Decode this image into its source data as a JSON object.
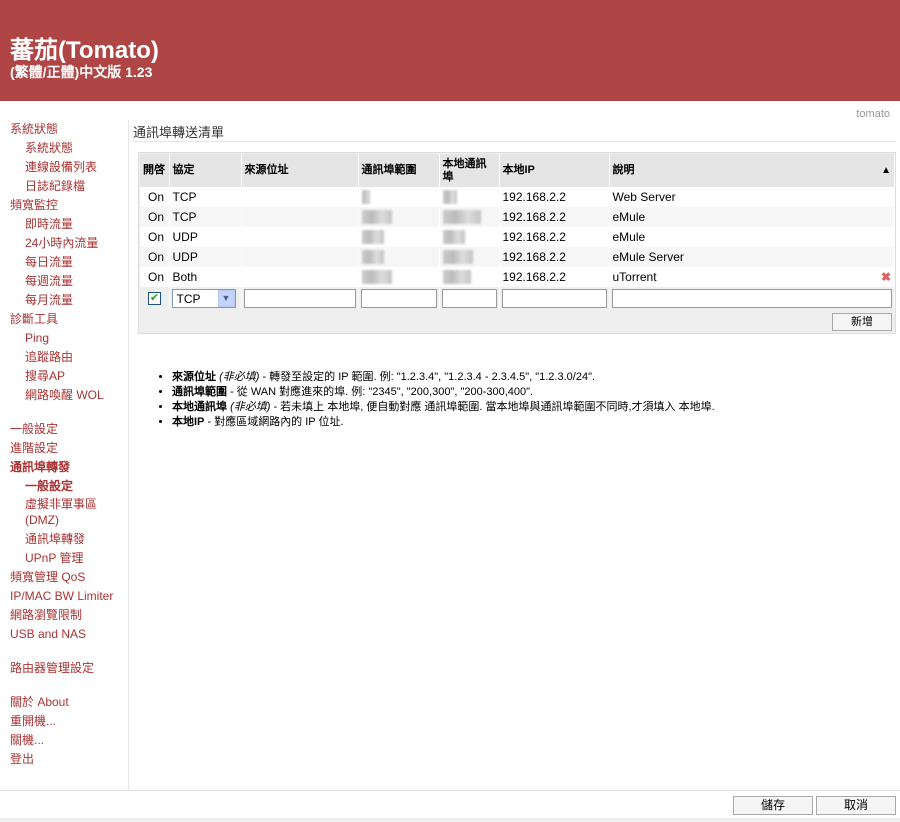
{
  "header": {
    "title": "蕃茄(Tomato)",
    "version": "(繁體/正體)中文版 1.23",
    "identity": "tomato"
  },
  "nav": [
    {
      "label": "系統狀態",
      "level": 1
    },
    {
      "label": "系統狀態",
      "level": 2
    },
    {
      "label": "連線設備列表",
      "level": 2
    },
    {
      "label": "日誌紀錄檔",
      "level": 2
    },
    {
      "label": "頻寬監控",
      "level": 1
    },
    {
      "label": "即時流量",
      "level": 2
    },
    {
      "label": "24小時內流量",
      "level": 2
    },
    {
      "label": "每日流量",
      "level": 2
    },
    {
      "label": "每週流量",
      "level": 2
    },
    {
      "label": "每月流量",
      "level": 2
    },
    {
      "label": "診斷工具",
      "level": 1
    },
    {
      "label": "Ping",
      "level": 2
    },
    {
      "label": "追蹤路由",
      "level": 2
    },
    {
      "label": "搜尋AP",
      "level": 2
    },
    {
      "label": "網路喚醒 WOL",
      "level": 2
    },
    {
      "label": "一般設定",
      "level": 1,
      "gap": true
    },
    {
      "label": "進階設定",
      "level": 1
    },
    {
      "label": "通訊埠轉發",
      "level": 1,
      "bold": true
    },
    {
      "label": "一般設定",
      "level": 2,
      "bold": true,
      "active": true
    },
    {
      "label": "虛擬非軍事區 (DMZ)",
      "level": 2
    },
    {
      "label": "通訊埠轉發",
      "level": 2
    },
    {
      "label": "UPnP 管理",
      "level": 2
    },
    {
      "label": "頻寬管理 QoS",
      "level": 1
    },
    {
      "label": "IP/MAC BW Limiter",
      "level": 1
    },
    {
      "label": "網路瀏覽限制",
      "level": 1
    },
    {
      "label": "USB and NAS",
      "level": 1
    },
    {
      "label": "路由器管理設定",
      "level": 1,
      "gap": true
    },
    {
      "label": "關於 About",
      "level": 1,
      "gap": true
    },
    {
      "label": "重開機...",
      "level": 1
    },
    {
      "label": "關機...",
      "level": 1
    },
    {
      "label": "登出",
      "level": 1
    }
  ],
  "section_title": "通訊埠轉送清單",
  "table": {
    "headers": [
      "開啓",
      "協定",
      "來源位址",
      "通訊埠範圍",
      "本地通訊埠",
      "本地IP",
      "說明"
    ],
    "rows": [
      {
        "on": "On",
        "proto": "TCP",
        "src": "",
        "ip": "192.168.2.2",
        "desc": "Web Server"
      },
      {
        "on": "On",
        "proto": "TCP",
        "src": "",
        "ip": "192.168.2.2",
        "desc": "eMule"
      },
      {
        "on": "On",
        "proto": "UDP",
        "src": "",
        "ip": "192.168.2.2",
        "desc": "eMule"
      },
      {
        "on": "On",
        "proto": "UDP",
        "src": "",
        "ip": "192.168.2.2",
        "desc": "eMule Server"
      },
      {
        "on": "On",
        "proto": "Both",
        "src": "",
        "ip": "192.168.2.2",
        "desc": "uTorrent"
      }
    ],
    "new_row": {
      "enabled": true,
      "proto": "TCP"
    },
    "add_label": "新增"
  },
  "notes": [
    {
      "term": "來源位址",
      "opt": "(非必填)",
      "text": " - 轉發至設定的 IP 範圍. 例: \"1.2.3.4\", \"1.2.3.4 - 2.3.4.5\", \"1.2.3.0/24\"."
    },
    {
      "term": "通訊埠範圍",
      "opt": "",
      "text": " - 從 WAN 對應進來的埠. 例: \"2345\", \"200,300\", \"200-300,400\"."
    },
    {
      "term": "本地通訊埠",
      "opt": "(非必填)",
      "text": " - 若未填上 本地埠, 便自動對應 通訊埠範圍. 當本地埠與通訊埠範圍不同時,才須填入 本地埠."
    },
    {
      "term": "本地IP",
      "opt": "",
      "text": " - 對應區域網路內的 IP 位址."
    }
  ],
  "footer": {
    "save": "儲存",
    "cancel": "取消"
  }
}
